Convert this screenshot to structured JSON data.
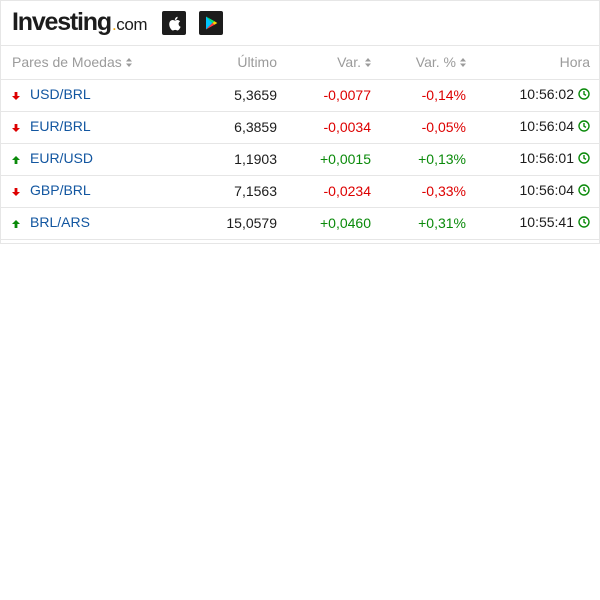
{
  "header": {
    "logo_main": "Investing",
    "logo_dot": ".",
    "logo_com": "com",
    "apple_store_icon": "apple-icon",
    "play_store_icon": "google-play-icon"
  },
  "table": {
    "columns": {
      "pair": "Pares de Moedas",
      "last": "Último",
      "change": "Var.",
      "change_pct": "Var. %",
      "time": "Hora"
    },
    "rows": [
      {
        "pair": "USD/BRL",
        "direction": "down",
        "last": "5,3659",
        "change": "-0,0077",
        "change_pct": "-0,14%",
        "time": "10:56:02"
      },
      {
        "pair": "EUR/BRL",
        "direction": "down",
        "last": "6,3859",
        "change": "-0,0034",
        "change_pct": "-0,05%",
        "time": "10:56:04"
      },
      {
        "pair": "EUR/USD",
        "direction": "up",
        "last": "1,1903",
        "change": "+0,0015",
        "change_pct": "+0,13%",
        "time": "10:56:01"
      },
      {
        "pair": "GBP/BRL",
        "direction": "down",
        "last": "7,1563",
        "change": "-0,0234",
        "change_pct": "-0,33%",
        "time": "10:56:04"
      },
      {
        "pair": "BRL/ARS",
        "direction": "up",
        "last": "15,0579",
        "change": "+0,0460",
        "change_pct": "+0,31%",
        "time": "10:55:41"
      }
    ]
  },
  "colors": {
    "negative": "#dd0000",
    "positive": "#0a8a0a",
    "link": "#1256a0",
    "logo_dot": "#f7a600",
    "clock": "#0a8a0a"
  }
}
